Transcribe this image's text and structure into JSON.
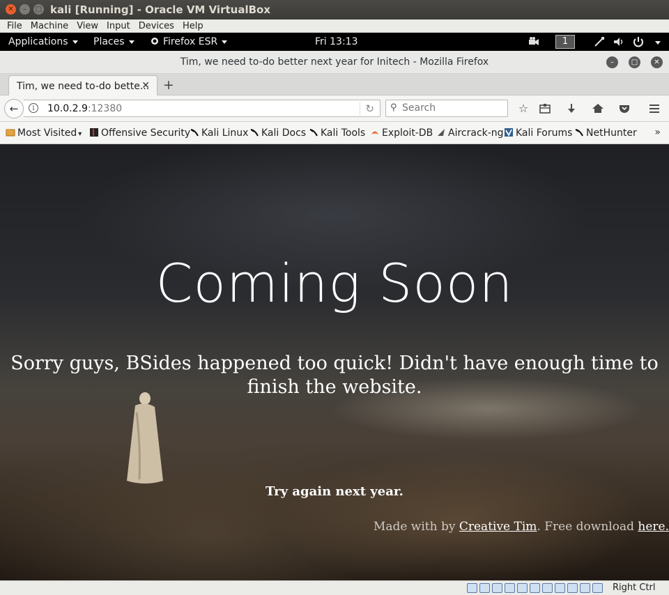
{
  "vbox": {
    "title": "kali [Running] - Oracle VM VirtualBox",
    "menu": [
      "File",
      "Machine",
      "View",
      "Input",
      "Devices",
      "Help"
    ],
    "host_key": "Right Ctrl"
  },
  "panel": {
    "applications": "Applications",
    "places": "Places",
    "app_name": "Firefox ESR",
    "clock": "Fri 13:13",
    "workspace": "1"
  },
  "firefox": {
    "window_title": "Tim, we need to-do better next year for Initech - Mozilla Firefox",
    "tab_label": "Tim, we need to-do bette...",
    "url_host": "10.0.2.9",
    "url_port": ":12380",
    "search_placeholder": "Search",
    "bookmarks": [
      {
        "label": "Most Visited",
        "icon": "folder-icon"
      },
      {
        "label": "Offensive Security",
        "icon": "offsec-icon"
      },
      {
        "label": "Kali Linux",
        "icon": "kali-dragon-icon"
      },
      {
        "label": "Kali Docs",
        "icon": "kali-dragon-icon"
      },
      {
        "label": "Kali Tools",
        "icon": "kali-dragon-icon"
      },
      {
        "label": "Exploit-DB",
        "icon": "exploitdb-icon"
      },
      {
        "label": "Aircrack-ng",
        "icon": "aircrack-icon"
      },
      {
        "label": "Kali Forums",
        "icon": "kali-forums-icon"
      },
      {
        "label": "NetHunter",
        "icon": "kali-dragon-icon"
      }
    ],
    "bookmarks_overflow": "»"
  },
  "page": {
    "heading": "Coming Soon",
    "message": "Sorry guys, BSides happened too quick! Didn't have enough time to finish the website.",
    "try_again": "Try again next year.",
    "made_with_prefix": "Made with by ",
    "made_with_link": "Creative Tim",
    "free_download": ". Free download ",
    "here_link": "here."
  }
}
